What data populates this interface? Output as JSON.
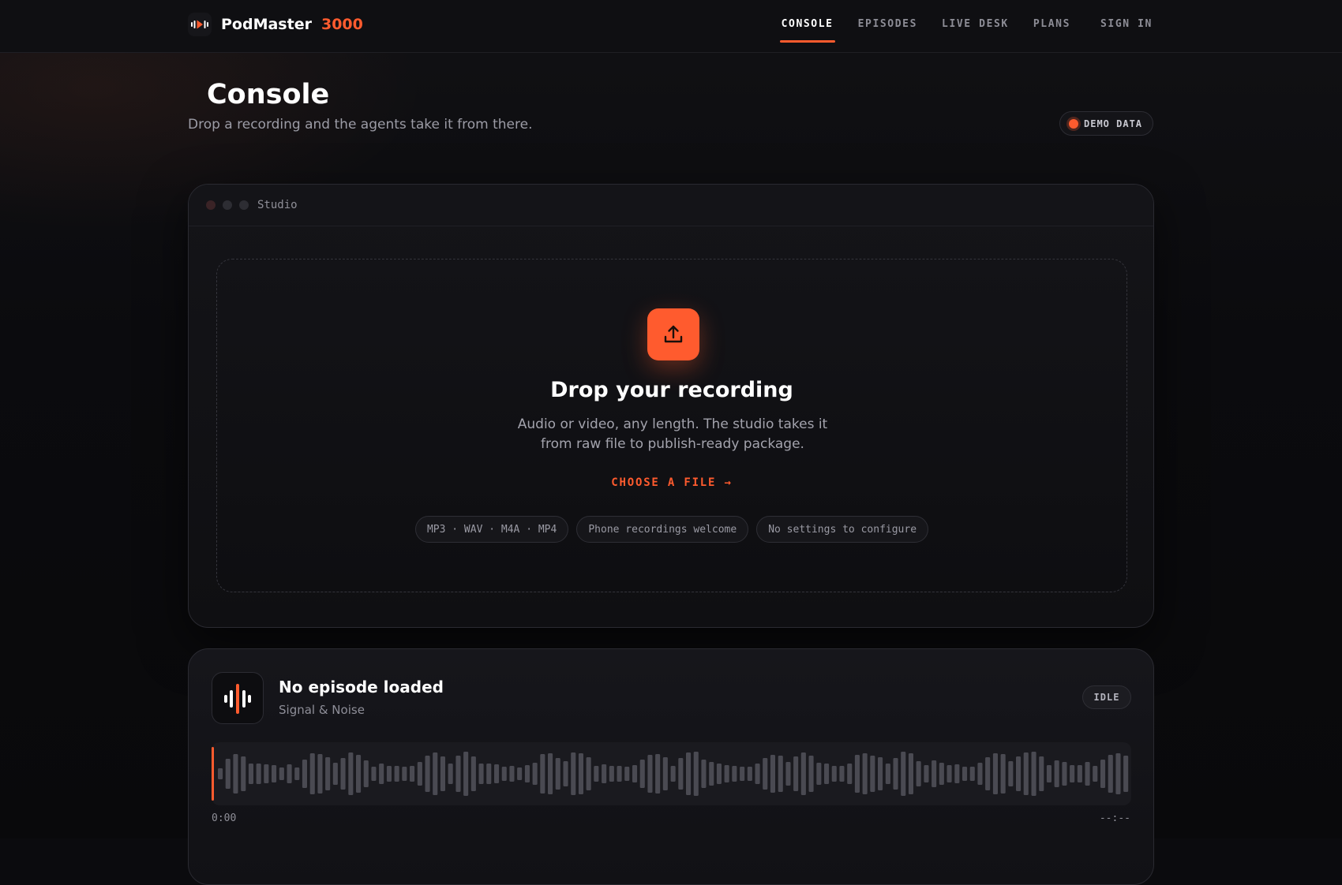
{
  "nav": {
    "brand_name": "PodMaster",
    "brand_number": "3000",
    "links": [
      {
        "label": "CONSOLE",
        "active": true
      },
      {
        "label": "EPISODES",
        "active": false
      },
      {
        "label": "LIVE DESK",
        "active": false
      },
      {
        "label": "PLANS",
        "active": false
      }
    ],
    "signin_label": "SIGN IN"
  },
  "header": {
    "title": "Console",
    "subtitle": "Drop a recording and the agents take it from there.",
    "badge": "DEMO DATA"
  },
  "studio": {
    "window_title": "Studio",
    "drop_title": "Drop your recording",
    "drop_description": "Audio or video, any length. The studio takes it from raw file to publish-ready package.",
    "choose_label": "CHOOSE A FILE →",
    "chips": [
      "MP3 · WAV · M4A · MP4",
      "Phone recordings welcome",
      "No settings to configure"
    ]
  },
  "player": {
    "title": "No episode loaded",
    "show": "Signal & Noise",
    "status": "IDLE",
    "time_current": "0:00",
    "time_total": "--:--",
    "progress": 0
  },
  "colors": {
    "accent": "#ff5b2e",
    "background": "#0b0b0e",
    "card": "#141418"
  },
  "icons": {
    "brand": "waveform-play-icon",
    "upload": "upload-icon",
    "episode_art": "waveform-icon"
  }
}
